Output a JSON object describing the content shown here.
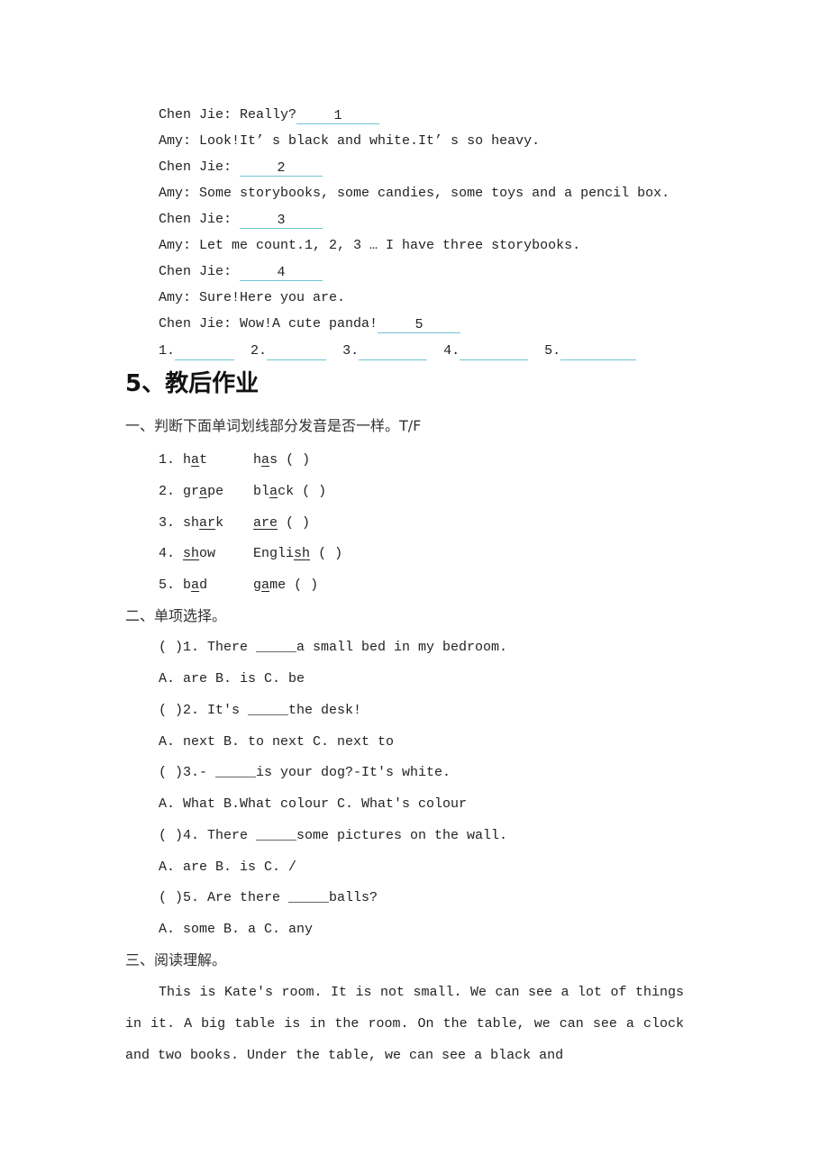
{
  "dialogue": [
    {
      "speaker": "Chen Jie: ",
      "text": "Really?",
      "blank": "1"
    },
    {
      "speaker": "Amy: ",
      "text": "Look!It’ s black and white.It’ s so heavy.",
      "blank": null
    },
    {
      "speaker": "Chen Jie: ",
      "text": "",
      "blank": "2"
    },
    {
      "speaker": "Amy: ",
      "text": "Some storybooks, some candies, some toys and a pencil box.",
      "blank": null
    },
    {
      "speaker": "Chen Jie: ",
      "text": "",
      "blank": "3"
    },
    {
      "speaker": "Amy: ",
      "text": "Let me count.1, 2, 3 … I have three storybooks.",
      "blank": null
    },
    {
      "speaker": "Chen Jie: ",
      "text": "",
      "blank": "4"
    },
    {
      "speaker": "Amy: ",
      "text": "Sure!Here you are.",
      "blank": null
    },
    {
      "speaker": "Chen Jie: ",
      "text": "Wow!A cute panda!",
      "blank": "5"
    }
  ],
  "answer_blanks": [
    "1.",
    "2.",
    "3.",
    "4.",
    "5."
  ],
  "section_heading": "5、教后作业",
  "part1": {
    "title": "一、判断下面单词划线部分发音是否一样。T/F",
    "items": [
      {
        "num": "1.",
        "w1": [
          "h",
          "a",
          "t"
        ],
        "w2": [
          "h",
          "a",
          "s"
        ],
        "paren": " ( )"
      },
      {
        "num": "2.",
        "w1": [
          "gr",
          "a",
          "pe"
        ],
        "w2": [
          "bl",
          "a",
          "ck"
        ],
        "paren": " ( )"
      },
      {
        "num": "3.",
        "w1": [
          "sh",
          "ar",
          "k"
        ],
        "w2": [
          "",
          "are",
          ""
        ],
        "paren": " ( )"
      },
      {
        "num": "4.",
        "w1": [
          "",
          "sh",
          "ow"
        ],
        "w2": [
          "Engli",
          "sh",
          ""
        ],
        "paren": " ( )"
      },
      {
        "num": "5.",
        "w1": [
          "b",
          "a",
          "d"
        ],
        "w2": [
          "g",
          "a",
          "me"
        ],
        "paren": " ( )"
      }
    ]
  },
  "part2": {
    "title": "二、单项选择。",
    "questions": [
      {
        "q": "( )1. There _____a small bed in my bedroom.",
        "opts": "A. are B. is C. be"
      },
      {
        "q": "( )2. It's _____the desk!",
        "opts": "A. next B. to next C. next to"
      },
      {
        "q": "( )3.- _____is your dog?-It's white.",
        "opts": "A. What B.What colour C. What's colour"
      },
      {
        "q": "( )4. There _____some pictures on the wall.",
        "opts": "A. are B. is C. /"
      },
      {
        "q": "( )5. Are there _____balls?",
        "opts": "A. some B. a C. any"
      }
    ]
  },
  "part3": {
    "title": "三、阅读理解。",
    "passage": "This is Kate's room. It is not small. We can see a lot of things in it. A big table is in the room. On the table, we can see a clock and two books. Under the table, we can see a black and"
  },
  "colors": {
    "blank_line": "#6fc4d4"
  }
}
